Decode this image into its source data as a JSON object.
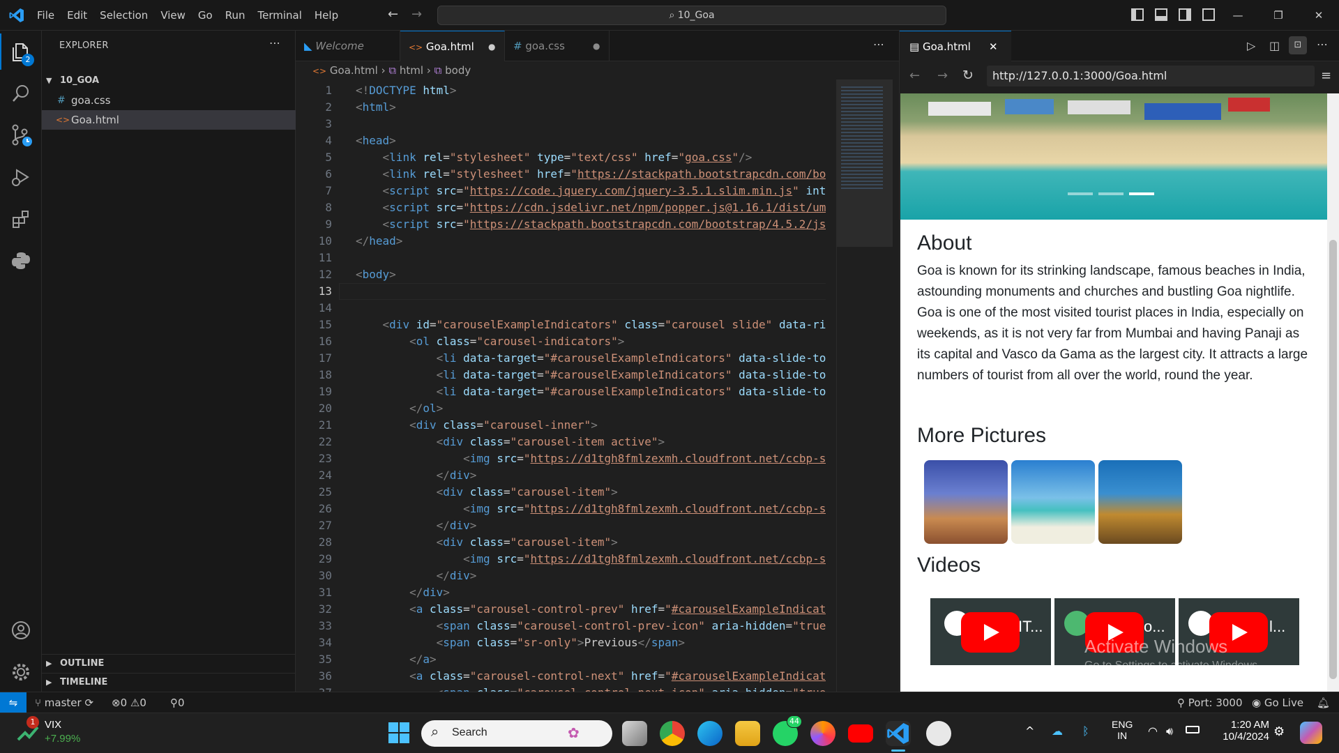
{
  "menu": [
    "File",
    "Edit",
    "Selection",
    "View",
    "Go",
    "Run",
    "Terminal",
    "Help"
  ],
  "command_center": "10_Goa",
  "activity_badge": "2",
  "explorer": {
    "title": "EXPLORER",
    "folder": "10_GOA",
    "files": [
      {
        "icon": "#",
        "name": "goa.css"
      },
      {
        "icon": "<>",
        "name": "Goa.html"
      }
    ],
    "outline": "OUTLINE",
    "timeline": "TIMELINE"
  },
  "tabs": [
    {
      "label": "Welcome"
    },
    {
      "label": "Goa.html"
    },
    {
      "label": "goa.css"
    }
  ],
  "breadcrumb": {
    "file": "Goa.html",
    "html": "html",
    "body": "body"
  },
  "code_lines": [
    {
      "n": "1"
    },
    {
      "n": "2"
    },
    {
      "n": "3"
    },
    {
      "n": "4"
    },
    {
      "n": "5"
    },
    {
      "n": "6"
    },
    {
      "n": "7"
    },
    {
      "n": "8"
    },
    {
      "n": "9"
    },
    {
      "n": "10"
    },
    {
      "n": "11"
    },
    {
      "n": "12"
    },
    {
      "n": "13"
    },
    {
      "n": "14"
    },
    {
      "n": "15"
    },
    {
      "n": "16"
    },
    {
      "n": "17"
    },
    {
      "n": "18"
    },
    {
      "n": "19"
    },
    {
      "n": "20"
    },
    {
      "n": "21"
    },
    {
      "n": "22"
    },
    {
      "n": "23"
    },
    {
      "n": "24"
    },
    {
      "n": "25"
    },
    {
      "n": "26"
    },
    {
      "n": "27"
    },
    {
      "n": "28"
    },
    {
      "n": "29"
    },
    {
      "n": "30"
    },
    {
      "n": "31"
    },
    {
      "n": "32"
    },
    {
      "n": "33"
    },
    {
      "n": "34"
    },
    {
      "n": "35"
    },
    {
      "n": "36"
    },
    {
      "n": "37"
    }
  ],
  "browser": {
    "tab_title": "Goa.html",
    "url": "http://127.0.0.1:3000/Goa.html",
    "about_heading": "About",
    "about_text": "Goa is known for its strinking landscape, famous beaches in India, astounding monuments and churches and bustling Goa nightlife. Goa is one of the most visited tourist places in India, especially on weekends, as it is not very far from Mumbai and having Panaji as its capital and Vasco da Gama as the largest city. It attracts a large numbers of tourist from all over the world, round the year.",
    "pictures_heading": "More Pictures",
    "videos_heading": "Videos",
    "video_titles": [
      "IT...",
      "o...",
      "l..."
    ],
    "watermark_title": "Activate Windows",
    "watermark_sub": "Go to Settings to activate Windows."
  },
  "statusbar": {
    "branch": "master",
    "errors": "0",
    "warnings": "0",
    "ports": "0",
    "port_label": "Port: 3000",
    "go_live": "Go Live"
  },
  "taskbar": {
    "vix_label": "VIX",
    "vix_change": "+7.99%",
    "vix_badge": "1",
    "search": "Search",
    "whatsapp_badge": "44",
    "lang_top": "ENG",
    "lang_bottom": "IN",
    "time": "1:20 AM",
    "date": "10/4/2024"
  },
  "colors": {
    "accent": "#0078d4",
    "status_bg": "#181818",
    "tag": "#569cd6",
    "attr": "#9cdcfe",
    "string": "#ce9178"
  }
}
